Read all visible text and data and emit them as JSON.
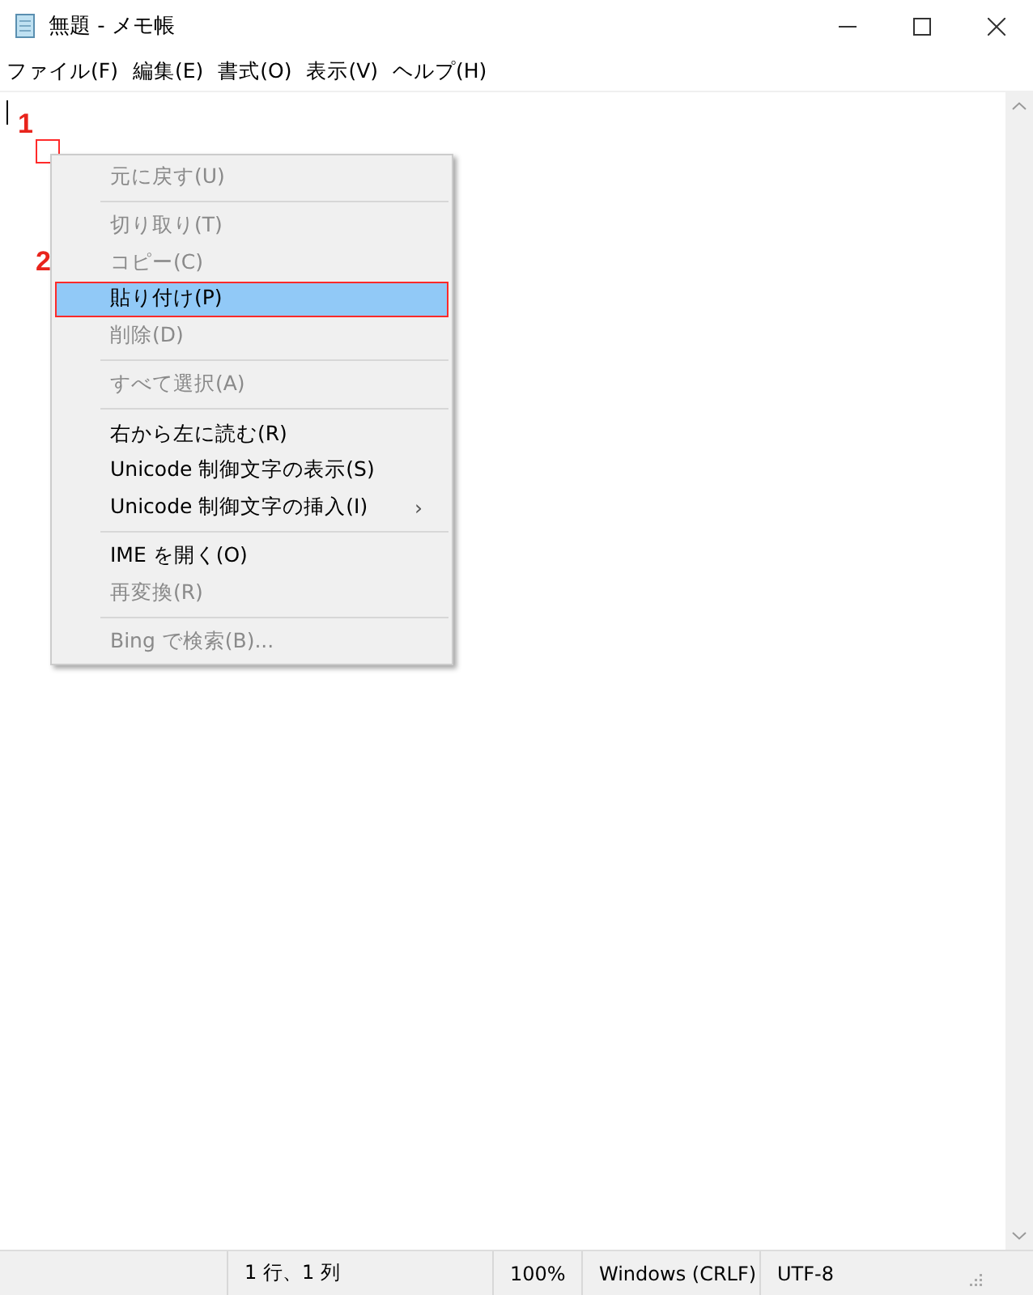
{
  "window": {
    "title": "無題 - メモ帳",
    "controls": [
      {
        "kind": "minimize"
      },
      {
        "kind": "maximize"
      },
      {
        "kind": "close"
      }
    ]
  },
  "menu_bar": [
    "ファイル(F)",
    "編集(E)",
    "書式(O)",
    "表示(V)",
    "ヘルプ(H)"
  ],
  "context_menu": [
    {
      "kind": "item",
      "label": "元に戻す(U)",
      "disabled": true,
      "selected": false
    },
    {
      "kind": "separator"
    },
    {
      "kind": "item",
      "label": "切り取り(T)",
      "disabled": true,
      "selected": false
    },
    {
      "kind": "item",
      "label": "コピー(C)",
      "disabled": true,
      "selected": false
    },
    {
      "kind": "item",
      "label": "貼り付け(P)",
      "disabled": false,
      "selected": true
    },
    {
      "kind": "item",
      "label": "削除(D)",
      "disabled": true,
      "selected": false
    },
    {
      "kind": "separator"
    },
    {
      "kind": "item",
      "label": "すべて選択(A)",
      "disabled": true,
      "selected": false
    },
    {
      "kind": "separator"
    },
    {
      "kind": "item",
      "label": "右から左に読む(R)",
      "disabled": false,
      "selected": false
    },
    {
      "kind": "item",
      "label": "Unicode 制御文字の表示(S)",
      "disabled": false,
      "selected": false
    },
    {
      "kind": "item",
      "label": "Unicode 制御文字の挿入(I)",
      "disabled": false,
      "selected": false,
      "submenu": "›"
    },
    {
      "kind": "separator"
    },
    {
      "kind": "item",
      "label": "IME を開く(O)",
      "disabled": false,
      "selected": false
    },
    {
      "kind": "item",
      "label": "再変換(R)",
      "disabled": true,
      "selected": false
    },
    {
      "kind": "separator"
    },
    {
      "kind": "item",
      "label": "Bing で検索(B)...",
      "disabled": true,
      "selected": false
    }
  ],
  "annotations": [
    {
      "label": "1",
      "kind": "click-point"
    },
    {
      "label": "2",
      "kind": "menu-item"
    }
  ],
  "status_bar": [
    "1 行、1 列",
    "100%",
    "Windows (CRLF)",
    "UTF-8"
  ]
}
